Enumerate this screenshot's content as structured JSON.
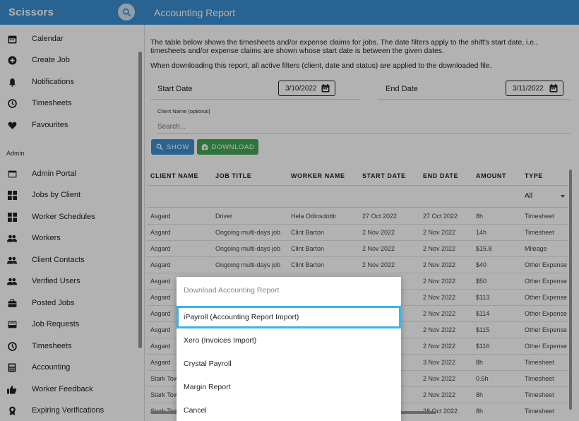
{
  "header": {
    "brand": "Scissors",
    "page_title": "Accounting Report"
  },
  "sidebar": {
    "items_top": [
      {
        "label": "Calendar",
        "icon": "calendar-icon"
      },
      {
        "label": "Create Job",
        "icon": "add-circle-icon"
      },
      {
        "label": "Notifications",
        "icon": "bell-icon"
      },
      {
        "label": "Timesheets",
        "icon": "clock-icon"
      },
      {
        "label": "Favourites",
        "icon": "heart-icon"
      }
    ],
    "section_label": "Admin",
    "items_admin": [
      {
        "label": "Admin Portal",
        "icon": "browser-icon"
      },
      {
        "label": "Jobs by Client",
        "icon": "grid-icon"
      },
      {
        "label": "Worker Schedules",
        "icon": "grid-icon"
      },
      {
        "label": "Workers",
        "icon": "people-icon"
      },
      {
        "label": "Client Contacts",
        "icon": "people-icon"
      },
      {
        "label": "Verified Users",
        "icon": "people-icon"
      },
      {
        "label": "Posted Jobs",
        "icon": "briefcase-icon"
      },
      {
        "label": "Job Requests",
        "icon": "inbox-icon"
      },
      {
        "label": "Timesheets",
        "icon": "clock-icon"
      },
      {
        "label": "Accounting",
        "icon": "calculator-icon"
      },
      {
        "label": "Worker Feedback",
        "icon": "thumbs-up-icon"
      },
      {
        "label": "Expiring Verifications",
        "icon": "badge-icon"
      }
    ]
  },
  "main": {
    "intro_text": "The table below shows the timesheets and/or expense claims for jobs. The date filters apply to the shift's start date, i.e., timesheets and/or expense claims are shown whose start date is between the given dates.",
    "download_note": "When downloading this report, all active filters (client, date and status) are applied to the downloaded file.",
    "start_date_label": "Start Date",
    "start_date_value": "3/10/2022",
    "end_date_label": "End Date",
    "end_date_value": "3/11/2022",
    "client_label": "Client Name (optional)",
    "client_placeholder": "Search...",
    "show_label": "SHOW",
    "download_label": "DOWNLOAD"
  },
  "table": {
    "columns": [
      "CLIENT NAME",
      "JOB TITLE",
      "WORKER NAME",
      "START DATE",
      "END DATE",
      "AMOUNT",
      "TYPE"
    ],
    "type_filter": "All",
    "rows": [
      [
        "Asgard",
        "Driver",
        "Hela Odinsdottir",
        "27 Oct 2022",
        "27 Oct 2022",
        "8h",
        "Timesheet"
      ],
      [
        "Asgard",
        "Ongoing multi-days job",
        "Clint Barton",
        "2 Nov 2022",
        "2 Nov 2022",
        "14h",
        "Timesheet"
      ],
      [
        "Asgard",
        "Ongoing multi-days job",
        "Clint Barton",
        "2 Nov 2022",
        "2 Nov 2022",
        "$15.8",
        "Mileage"
      ],
      [
        "Asgard",
        "Ongoing multi-days job",
        "Clint Barton",
        "2 Nov 2022",
        "2 Nov 2022",
        "$40",
        "Other Expense"
      ],
      [
        "Asgard",
        "",
        "",
        "",
        "2 Nov 2022",
        "$50",
        "Other Expense"
      ],
      [
        "Asgard",
        "",
        "",
        "",
        "2 Nov 2022",
        "$113",
        "Other Expense"
      ],
      [
        "Asgard",
        "",
        "",
        "",
        "2 Nov 2022",
        "$114",
        "Other Expense"
      ],
      [
        "Asgard",
        "",
        "",
        "",
        "2 Nov 2022",
        "$115",
        "Other Expense"
      ],
      [
        "Asgard",
        "",
        "",
        "",
        "2 Nov 2022",
        "$116",
        "Other Expense"
      ],
      [
        "Asgard",
        "",
        "",
        "",
        "3 Nov 2022",
        "8h",
        "Timesheet"
      ],
      [
        "Stark Tow",
        "",
        "",
        "",
        "2 Nov 2022",
        "0.5h",
        "Timesheet"
      ],
      [
        "Stark Tow",
        "",
        "",
        "",
        "2 Nov 2022",
        "8h",
        "Timesheet"
      ],
      [
        "Stark Tow",
        "",
        "",
        "",
        "28 Oct 2022",
        "8h",
        "Timesheet"
      ]
    ]
  },
  "dialog": {
    "title": "Download Accounting Report",
    "options": [
      "iPayroll (Accounting Report Import)",
      "Xero (Invoices Import)",
      "Crystal Payroll",
      "Margin Report",
      "Cancel"
    ]
  },
  "colors": {
    "header_blue": "#3c8fd0",
    "download_green": "#43a755",
    "focus_ring": "#3bb4e8"
  }
}
